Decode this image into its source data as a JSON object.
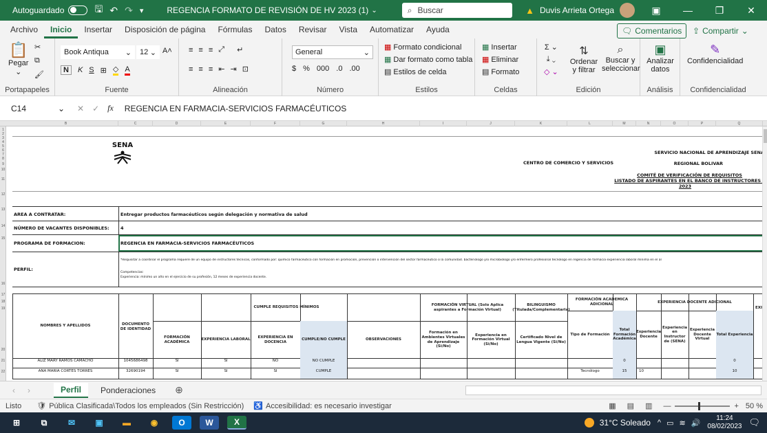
{
  "title_bar": {
    "autosave": "Autoguardado",
    "doc_title": "REGENCIA FORMATO DE REVISIÓN DE HV 2023 (1)",
    "search": "Buscar",
    "user": "Duvis Arrieta Ortega"
  },
  "menu": {
    "tabs": [
      "Archivo",
      "Inicio",
      "Insertar",
      "Disposición de página",
      "Fórmulas",
      "Datos",
      "Revisar",
      "Vista",
      "Automatizar",
      "Ayuda"
    ],
    "comments": "Comentarios",
    "share": "Compartir"
  },
  "ribbon": {
    "clipboard": {
      "paste": "Pegar",
      "label": "Portapapeles"
    },
    "font": {
      "name": "Book Antiqua",
      "size": "12",
      "label": "Fuente"
    },
    "alignment": {
      "label": "Alineación"
    },
    "number": {
      "format": "General",
      "label": "Número"
    },
    "styles": {
      "cond": "Formato condicional",
      "table": "Dar formato como tabla",
      "cell": "Estilos de celda",
      "label": "Estilos"
    },
    "cells": {
      "insert": "Insertar",
      "delete": "Eliminar",
      "format": "Formato",
      "label": "Celdas"
    },
    "editing": {
      "sort": "Ordenar y filtrar",
      "find": "Buscar y seleccionar",
      "label": "Edición"
    },
    "analysis": {
      "analyze": "Analizar datos",
      "label": "Análisis"
    },
    "sensitivity": {
      "btn": "Confidencialidad",
      "label": "Confidencialidad"
    }
  },
  "formula_bar": {
    "name_box": "C14",
    "fx": "fx",
    "content": "REGENCIA EN FARMACIA-SERVICIOS FARMACÉUTICOS"
  },
  "sheet": {
    "col_headers": [
      "B",
      "C",
      "D",
      "E",
      "F",
      "G",
      "H",
      "I",
      "J",
      "K",
      "L",
      "M",
      "N",
      "O",
      "P",
      "Q"
    ],
    "row_headers": [
      "1",
      "2",
      "3",
      "4",
      "5",
      "6",
      "7",
      "8",
      "9",
      "10",
      "11",
      "12",
      "13",
      "14",
      "15",
      "16",
      "17",
      "18",
      "19",
      "20",
      "21",
      "22"
    ],
    "header_right": [
      "SERVICIO NACIONAL DE APRENDIZAJE SENA",
      "REGIONAL BOLIVAR",
      "COMITÉ DE VERIFICACIÓN DE REQUISITOS",
      "LISTADO DE ASPIRANTES EN EL BANCO DE INSTRUCTORES S",
      "2023"
    ],
    "center": "CENTRO DE COMERCIO Y SERVICIOS",
    "logo": "SENA",
    "area_label": "AREA A CONTRATAR:",
    "area_value": "Entregar productos farmacéuticos según delegación y normativa de salud",
    "vacancies_label": "NÚMERO DE VACANTES DISPONIBLES:",
    "vacancies_value": "4",
    "program_label": "PROGRAMA DE FORMACION:",
    "program_value": "REGENCIA EN FARMACIA-SERVICIOS FARMACÉUTICOS",
    "profile_label": "PERFIL:",
    "profile_text": "*Requisitar a coordinar el programa requiere de un equipo de instructores técnicos, conformado por: químico farmacéutico con formación en promoción, prevención o intervención del sector farmacéutico o la comunidad. bacteriólogo y/o microbiólogo y/o enfermero profesional tecnólogo en regencia de farmacia experiencia laboral mínima en el al",
    "profile_competencies": "Competencias:",
    "profile_experience": "Experiencia: mínimo un año en el ejercicio de su profesión, 12 meses de experiencia docente.",
    "table_headers": {
      "name": "NOMBRES Y APELLIDOS",
      "doc": "DOCUMENTO DE IDENTIDAD",
      "min_req": "CUMPLE REQUISITOS MÍNIMOS",
      "academic": "FORMACIÓN ACADÉMICA",
      "labor": "EXPERIENCIA LABORAL",
      "teaching": "EXPERIENCIA EN DOCENCIA",
      "complies": "CUMPLE/NO CUMPLE",
      "obs": "OBSERVACIONES",
      "virtual": "FORMACIÓN VIRTUAL (Solo Aplica aspirantes a Formación Virtual)",
      "virtual_a": "Formación en Ambientes Virtuales de Aprendizaje (Si/No)",
      "virtual_b": "Experiencia en Formación Virtual (Si/No)",
      "bilingual": "BILINGUISMO (Titulada/Complementaria)",
      "bilingual_a": "Certificado Nivel de Lengua Vigente (Si/No)",
      "extra_acad": "FORMACIÓN ACADEMICA ADICIONAL",
      "training_type": "Tipo de Formación",
      "total_acad": "Total Formación Académica",
      "teach_extra": "EXPERIENCIA DOCENTE ADICIONAL",
      "exp_teacher": "Experiencia Docente",
      "exp_inst": "Experiencia en Instructor de (SENA)",
      "exp_virtual": "Experiencia Docente Virtual",
      "total_exp": "Total Experiencia",
      "cut": "EXI"
    },
    "rows": [
      {
        "name": "ALIZ MARY RAMOS CAMACHO",
        "doc": "1045686498",
        "acad": "SI",
        "labor": "SI",
        "teach": "NO",
        "status": "NO CUMPLE",
        "type": "",
        "total_acad": "0",
        "t1": "",
        "total_exp": "0"
      },
      {
        "name": "ANA MARIA CORTES TORRES",
        "doc": "32690194",
        "acad": "SI",
        "labor": "SI",
        "teach": "SI",
        "status": "CUMPLE",
        "type": "Tecnólogo",
        "total_acad": "15",
        "t1": "10",
        "total_exp": "10"
      }
    ]
  },
  "sheet_tabs": [
    "Perfil",
    "Ponderaciones"
  ],
  "status": {
    "ready": "Listo",
    "classification": "Pública Clasificada\\Todos los empleados (Sin Restricción)",
    "accessibility": "Accesibilidad: es necesario investigar",
    "zoom": "50 %"
  },
  "taskbar": {
    "weather": "31°C Soleado",
    "time": "11:24",
    "date": "08/02/2023"
  },
  "colors": {
    "excel_green": "#217346",
    "taskbar": "#1c2a3a",
    "highlight_col": "#dce6f1"
  }
}
